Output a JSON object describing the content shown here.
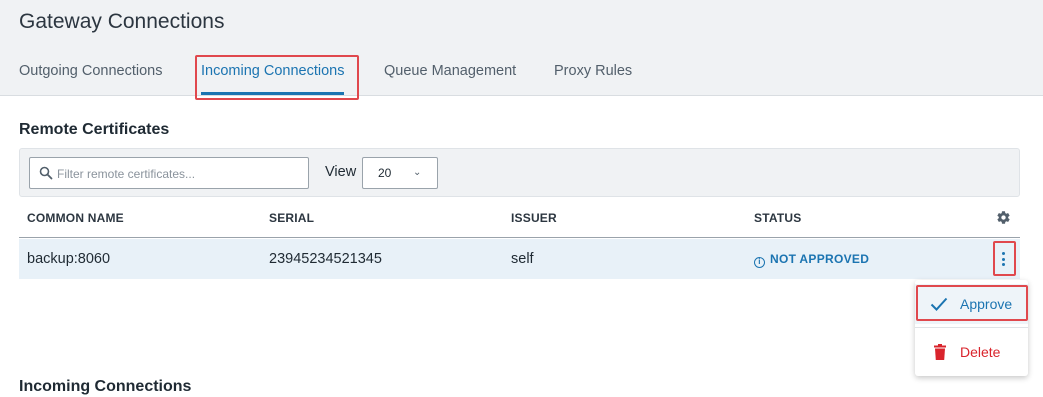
{
  "page": {
    "title": "Gateway Connections"
  },
  "tabs": [
    {
      "label": "Outgoing Connections",
      "active": false
    },
    {
      "label": "Incoming Connections",
      "active": true
    },
    {
      "label": "Queue Management",
      "active": false
    },
    {
      "label": "Proxy Rules",
      "active": false
    }
  ],
  "remote_certificates": {
    "title": "Remote Certificates",
    "filter_placeholder": "Filter remote certificates...",
    "view_label": "View",
    "view_value": "20",
    "columns": [
      "COMMON NAME",
      "SERIAL",
      "ISSUER",
      "STATUS"
    ],
    "rows": [
      {
        "common_name": "backup:8060",
        "serial": "23945234521345",
        "issuer": "self",
        "status": "NOT APPROVED"
      }
    ]
  },
  "row_menu": {
    "approve": "Approve",
    "delete": "Delete"
  },
  "incoming_connections": {
    "title": "Incoming Connections"
  },
  "icons": {
    "search": "search-icon",
    "chevron": "chevron-down-icon",
    "settings": "gear-icon",
    "status": "info-icon",
    "more": "kebab-icon",
    "approve": "check-icon",
    "delete": "trash-icon"
  },
  "colors": {
    "accent": "#1b74b1",
    "danger": "#d9242c",
    "highlight": "#e0484d",
    "header_bg": "#f0f2f4",
    "selected_row": "#e8f1f8"
  }
}
